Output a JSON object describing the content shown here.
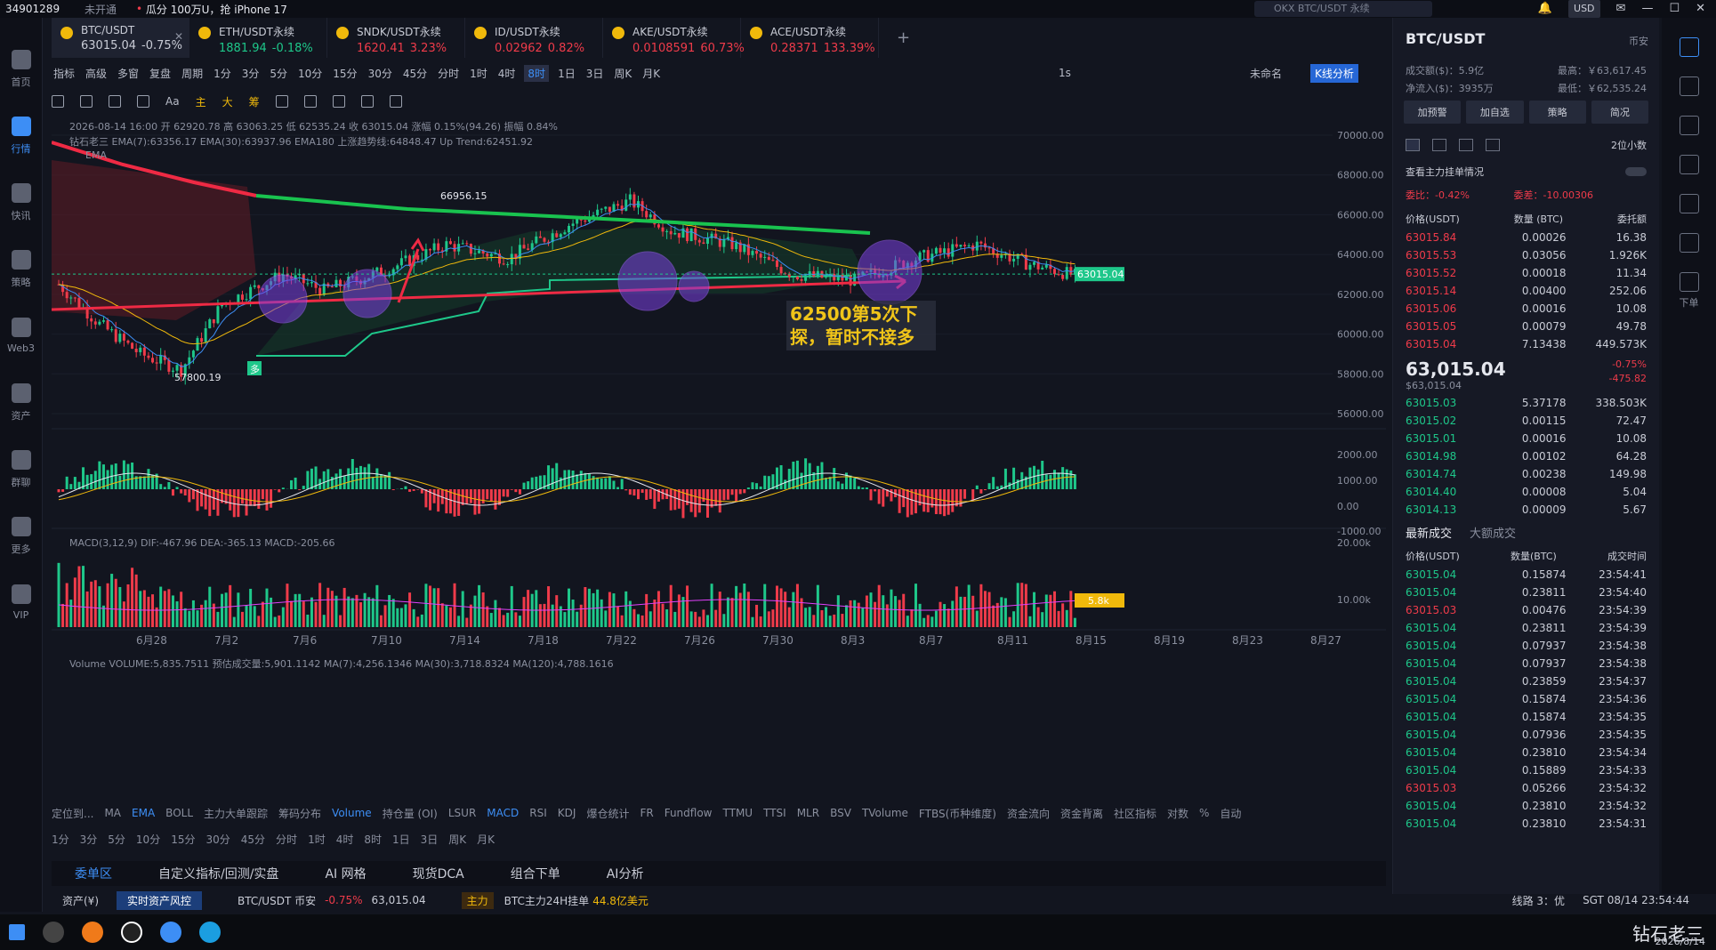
{
  "topbar": {
    "account": "34901289",
    "status": "未开通",
    "promo": "瓜分 100万U，抢 iPhone 17",
    "search_placeholder": "OKX BTC/USDT 永续",
    "currency": "USD"
  },
  "left_nav": [
    {
      "label": "首页"
    },
    {
      "label": "行情"
    },
    {
      "label": "快讯"
    },
    {
      "label": "策略"
    },
    {
      "label": "Web3"
    },
    {
      "label": "资产"
    },
    {
      "label": "群聊"
    },
    {
      "label": "更多"
    },
    {
      "label": "VIP"
    }
  ],
  "tabs": [
    {
      "name": "BTC/USDT",
      "price": "63015.04",
      "change": "-0.75%",
      "dir": "down"
    },
    {
      "name": "ETH/USDT永续",
      "price": "1881.94",
      "change": "-0.18%",
      "dir": "up"
    },
    {
      "name": "SNDK/USDT永续",
      "price": "1620.41",
      "change": "3.23%",
      "dir": "down"
    },
    {
      "name": "ID/USDT永续",
      "price": "0.02962",
      "change": "0.82%",
      "dir": "down"
    },
    {
      "name": "AKE/USDT永续",
      "price": "0.0108591",
      "change": "60.73%",
      "dir": "down"
    },
    {
      "name": "ACE/USDT永续",
      "price": "0.28371",
      "change": "133.39%",
      "dir": "down"
    }
  ],
  "toolbar1": {
    "items": [
      "指标",
      "高级",
      "多窗",
      "复盘",
      "周期",
      "1分",
      "3分",
      "5分",
      "10分",
      "15分",
      "30分",
      "45分",
      "分时",
      "1时",
      "4时",
      "8时",
      "1日",
      "3日",
      "周K",
      "月K"
    ],
    "selected": "8时",
    "seconds": "1s",
    "layout_name": "未命名",
    "analysis": "K线分析"
  },
  "toolbar2": {
    "items": [
      "主",
      "大",
      "筹"
    ]
  },
  "info": {
    "ohlc": "2026-08-14 16:00 开 62920.78 高 63063.25 低 62535.24 收 63015.04 涨幅 0.15%(94.26) 振幅 0.84%",
    "ema": "钻石老三 EMA(7):63356.17 EMA(30):63937.96 EMA180 上涨趋势线:64848.47 Up Trend:62451.92",
    "ema_short": "EMA",
    "macd": "MACD(3,12,9) DIF:-467.96 DEA:-365.13 MACD:-205.66",
    "volume": "Volume VOLUME:5,835.7511 预估成交量:5,901.1142 MA(7):4,256.1346 MA(30):3,718.8324 MA(120):4,788.1616"
  },
  "annotations": {
    "high": "66956.15",
    "low": "57800.19",
    "note_line1": "62500第5次下",
    "note_line2": "探，暂时不接多",
    "signal": "多"
  },
  "price_axis": [
    "70000.00",
    "68000.00",
    "66000.00",
    "64000.00",
    "62000.00",
    "60000.00",
    "58000.00",
    "56000.00"
  ],
  "current_price_tag": "63015.04",
  "macd_axis": [
    "2000.00",
    "1000.00",
    "0.00",
    "-1000.00"
  ],
  "vol_axis": [
    "20.00k",
    "10.00k"
  ],
  "vol_tag": "5.8k",
  "date_axis": [
    "6月28",
    "7月2",
    "7月6",
    "7月10",
    "7月14",
    "7月18",
    "7月22",
    "7月26",
    "7月30",
    "8月3",
    "8月7",
    "8月11",
    "8月15",
    "8月19",
    "8月23",
    "8月27"
  ],
  "toolbar3": {
    "items": [
      "定位到...",
      "MA",
      "EMA",
      "BOLL",
      "主力大单跟踪",
      "筹码分布",
      "Volume",
      "持仓量 (OI)",
      "LSUR",
      "MACD",
      "RSI",
      "KDJ",
      "爆仓统计",
      "FR",
      "Fundflow",
      "TTMU",
      "TTSI",
      "MLR",
      "BSV",
      "TVolume",
      "FTBS(币种维度)",
      "资金流向",
      "资金背离",
      "社区指标",
      "对数",
      "%",
      "自动"
    ]
  },
  "toolbar4": [
    "1分",
    "3分",
    "5分",
    "10分",
    "15分",
    "30分",
    "45分",
    "分时",
    "1时",
    "4时",
    "8时",
    "1日",
    "3日",
    "周K",
    "月K"
  ],
  "bottom_tabs": [
    "委单区",
    "自定义指标/回测/实盘",
    "AI 网格",
    "现货DCA",
    "组合下单",
    "AI分析"
  ],
  "statusbar": {
    "assets": "资产(¥)",
    "risk": "实时资产风控",
    "pair": "BTC/USDT 币安",
    "change": "-0.75%",
    "price": "63,015.04",
    "tag": "主力",
    "news": "BTC主力24H挂单",
    "amount": "44.8亿美元",
    "line": "线路 3：优",
    "time": "SGT 08/14 23:54:44"
  },
  "taskbar": {
    "brand": "钻石老三",
    "date": "2026/8/14"
  },
  "right": {
    "symbol": "BTC/USDT",
    "exchange": "币安",
    "stats": [
      [
        "成交额($)：5.9亿",
        "最高：￥63,617.45"
      ],
      [
        "净流入($)：3935万",
        "最低：￥62,535.24"
      ]
    ],
    "buttons": [
      "加预警",
      "加自选",
      "策略",
      "简况"
    ],
    "decimals": "2位小数",
    "whale": "查看主力挂单情况",
    "ratio": "委比：-0.42%",
    "diff": "委差：-10.00306",
    "ob_headers": [
      "价格(USDT)",
      "数量 (BTC)",
      "委托额"
    ],
    "asks": [
      [
        "63015.84",
        "0.00026",
        "16.38"
      ],
      [
        "63015.53",
        "0.03056",
        "1.926K"
      ],
      [
        "63015.52",
        "0.00018",
        "11.34"
      ],
      [
        "63015.14",
        "0.00400",
        "252.06"
      ],
      [
        "63015.06",
        "0.00016",
        "10.08"
      ],
      [
        "63015.05",
        "0.00079",
        "49.78"
      ],
      [
        "63015.04",
        "7.13438",
        "449.573K"
      ]
    ],
    "mid_price": "63,015.04",
    "mid_sub": "$63,015.04",
    "mid_pct": "-0.75%",
    "mid_chg": "-475.82",
    "bids": [
      [
        "63015.03",
        "5.37178",
        "338.503K"
      ],
      [
        "63015.02",
        "0.00115",
        "72.47"
      ],
      [
        "63015.01",
        "0.00016",
        "10.08"
      ],
      [
        "63014.98",
        "0.00102",
        "64.28"
      ],
      [
        "63014.74",
        "0.00238",
        "149.98"
      ],
      [
        "63014.40",
        "0.00008",
        "5.04"
      ],
      [
        "63014.13",
        "0.00009",
        "5.67"
      ]
    ],
    "trade_tabs": [
      "最新成交",
      "大额成交"
    ],
    "trade_headers": [
      "价格(USDT)",
      "数量(BTC)",
      "成交时间"
    ],
    "trades": [
      [
        "63015.04",
        "0.15874",
        "23:54:41",
        "up"
      ],
      [
        "63015.04",
        "0.23811",
        "23:54:40",
        "up"
      ],
      [
        "63015.03",
        "0.00476",
        "23:54:39",
        "down"
      ],
      [
        "63015.04",
        "0.23811",
        "23:54:39",
        "up"
      ],
      [
        "63015.04",
        "0.07937",
        "23:54:38",
        "up"
      ],
      [
        "63015.04",
        "0.07937",
        "23:54:38",
        "up"
      ],
      [
        "63015.04",
        "0.23859",
        "23:54:37",
        "up"
      ],
      [
        "63015.04",
        "0.15874",
        "23:54:36",
        "up"
      ],
      [
        "63015.04",
        "0.15874",
        "23:54:35",
        "up"
      ],
      [
        "63015.04",
        "0.07936",
        "23:54:35",
        "up"
      ],
      [
        "63015.04",
        "0.23810",
        "23:54:34",
        "up"
      ],
      [
        "63015.04",
        "0.15889",
        "23:54:33",
        "up"
      ],
      [
        "63015.03",
        "0.05266",
        "23:54:32",
        "down"
      ],
      [
        "63015.04",
        "0.23810",
        "23:54:32",
        "up"
      ],
      [
        "63015.04",
        "0.23810",
        "23:54:31",
        "up"
      ]
    ]
  },
  "right_sidebar": [
    "下单"
  ]
}
